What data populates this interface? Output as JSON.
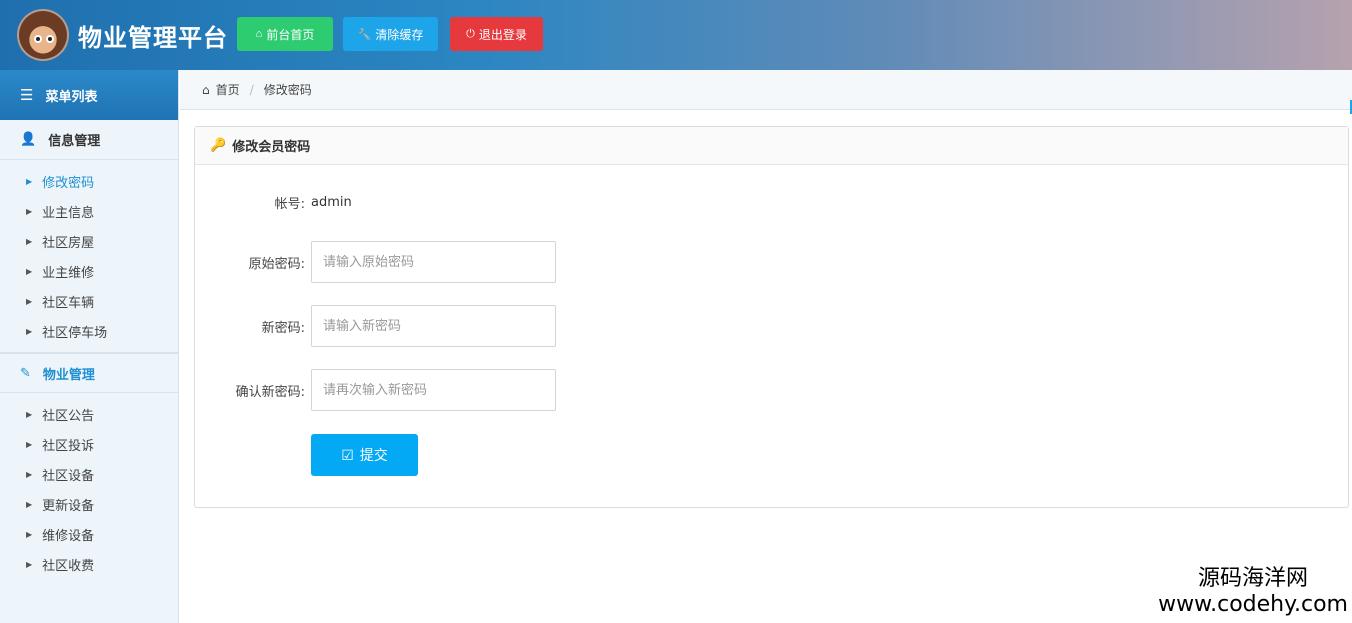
{
  "header": {
    "site_title": "物业管理平台",
    "buttons": [
      {
        "label": "前台首页",
        "icon": "home-icon",
        "color": "#2ecc71"
      },
      {
        "label": "清除缓存",
        "icon": "wrench-icon",
        "color": "#1ea5e9"
      },
      {
        "label": "退出登录",
        "icon": "power-icon",
        "color": "#e6393e"
      }
    ]
  },
  "sidebar": {
    "menu_title": "菜单列表",
    "groups": [
      {
        "label": "信息管理",
        "icon": "user-icon",
        "items": [
          {
            "label": "修改密码",
            "active": true
          },
          {
            "label": "业主信息"
          },
          {
            "label": "社区房屋"
          },
          {
            "label": "业主维修"
          },
          {
            "label": "社区车辆"
          },
          {
            "label": "社区停车场"
          }
        ]
      },
      {
        "label": "物业管理",
        "icon": "edit-icon",
        "items": [
          {
            "label": "社区公告"
          },
          {
            "label": "社区投诉"
          },
          {
            "label": "社区设备"
          },
          {
            "label": "更新设备"
          },
          {
            "label": "维修设备"
          },
          {
            "label": "社区收费"
          }
        ]
      }
    ]
  },
  "breadcrumb": {
    "home": "首页",
    "current": "修改密码"
  },
  "form": {
    "title": "修改会员密码",
    "account_label": "帐号:",
    "account_value": "admin",
    "old_password_label": "原始密码:",
    "old_password_placeholder": "请输入原始密码",
    "new_password_label": "新密码:",
    "new_password_placeholder": "请输入新密码",
    "confirm_password_label": "确认新密码:",
    "confirm_password_placeholder": "请再次输入新密码",
    "submit_label": "提交"
  },
  "watermark": {
    "line1": "源码海洋网",
    "line2": "www.codehy.com"
  }
}
